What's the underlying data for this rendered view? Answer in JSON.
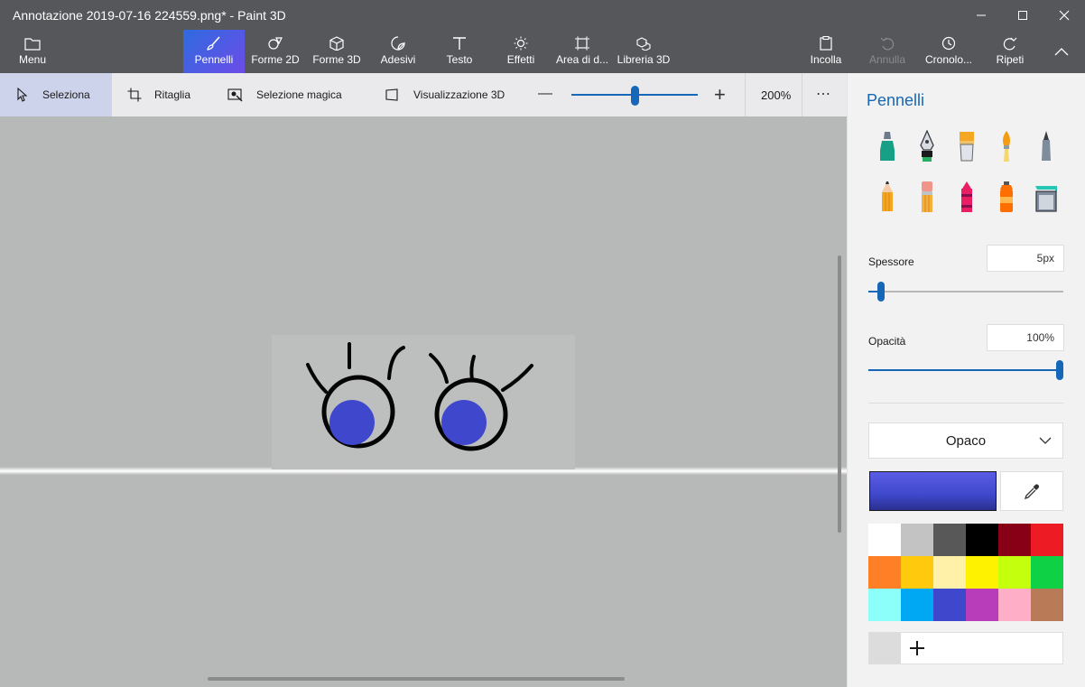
{
  "window": {
    "title": "Annotazione 2019-07-16 224559.png* - Paint 3D"
  },
  "ribbon": {
    "menu_label": "Menu",
    "tabs": [
      "Pennelli",
      "Forme 2D",
      "Forme 3D",
      "Adesivi",
      "Testo",
      "Effetti",
      "Area di d...",
      "Libreria 3D"
    ],
    "active_tab": "Pennelli",
    "right_actions": [
      "Incolla",
      "Annulla",
      "Cronolo...",
      "Ripeti"
    ]
  },
  "toolbar": {
    "select_label": "Seleziona",
    "crop_label": "Ritaglia",
    "magic_label": "Selezione magica",
    "view3d_label": "Visualizzazione 3D",
    "zoom_minus": "—",
    "zoom_plus": "+",
    "zoom_value": "200%",
    "more_label": "⋯",
    "zoom_level_fraction": 0.5
  },
  "panel": {
    "title": "Pennelli",
    "brushes": [
      "marker-icon",
      "calligraphy-pen-icon",
      "oil-brush-icon",
      "watercolor-icon",
      "pixel-pen-icon",
      "pencil-icon",
      "eraser-icon",
      "crayon-icon",
      "spray-can-icon",
      "fill-bucket-icon"
    ],
    "thickness_label": "Spessore",
    "thickness_value": "5px",
    "thickness_fraction": 0.05,
    "opacity_label": "Opacità",
    "opacity_value": "100%",
    "opacity_fraction": 1.0,
    "finish_label": "Opaco",
    "selected_color": "#3f48cc",
    "palette": [
      "#ffffff",
      "#c3c3c3",
      "#585858",
      "#000000",
      "#880015",
      "#ed1c24",
      "#ff7f27",
      "#ffc90e",
      "#fff2a8",
      "#fff200",
      "#c4ff0e",
      "#0ed145",
      "#8cfffb",
      "#00a8f3",
      "#3f48cc",
      "#b83dba",
      "#ffaec8",
      "#b97a57"
    ],
    "add_color_label": "+"
  }
}
